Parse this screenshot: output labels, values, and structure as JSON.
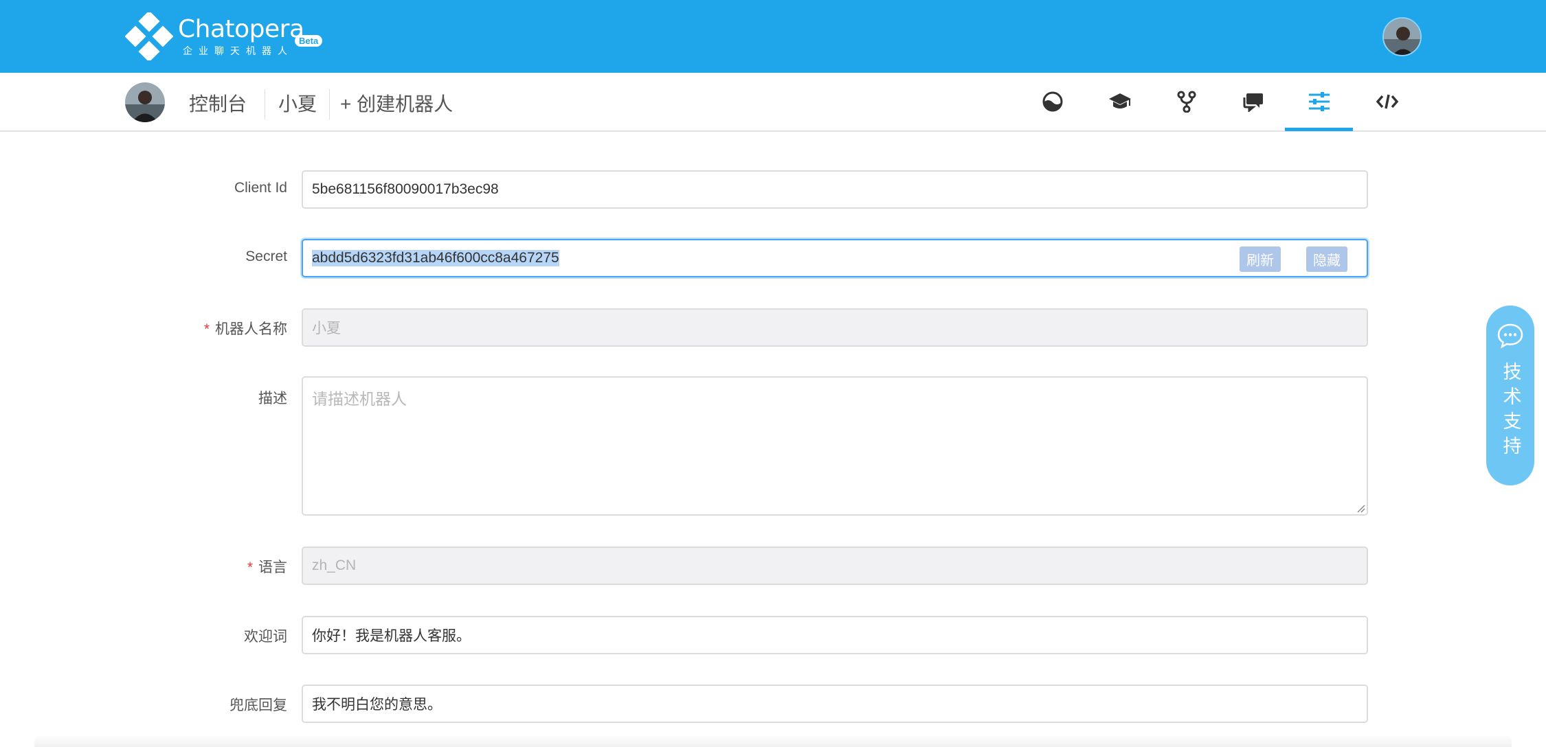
{
  "header": {
    "brand_name": "Chatopera",
    "brand_subtitle": "企业聊天机器人",
    "beta_badge": "Beta"
  },
  "subnav": {
    "console_label": "控制台",
    "bot_name": "小夏",
    "create_bot_label": "+ 创建机器人",
    "icons": [
      "dashboard-icon",
      "graduation-cap-icon",
      "branch-icon",
      "chat-bubbles-icon",
      "sliders-icon",
      "code-icon"
    ],
    "active_tab": "sliders-icon"
  },
  "form": {
    "client_id": {
      "label": "Client Id",
      "value": "5be681156f80090017b3ec98"
    },
    "secret": {
      "label": "Secret",
      "value": "abdd5d6323fd31ab46f600cc8a467275",
      "refresh_label": "刷新",
      "hide_label": "隐藏"
    },
    "bot_name": {
      "label": "机器人名称",
      "required_mark": "*",
      "value": "小夏"
    },
    "description": {
      "label": "描述",
      "placeholder": "请描述机器人",
      "value": ""
    },
    "language": {
      "label": "语言",
      "required_mark": "*",
      "value": "zh_CN"
    },
    "welcome": {
      "label": "欢迎词",
      "value": "你好！我是机器人客服。"
    },
    "fallback": {
      "label": "兜底回复",
      "value": "我不明白您的意思。"
    }
  },
  "support": {
    "label": "技术支持"
  },
  "colors": {
    "primary": "#1ea5ea",
    "support_widget": "#6ec6f5",
    "required": "#e4393c"
  }
}
